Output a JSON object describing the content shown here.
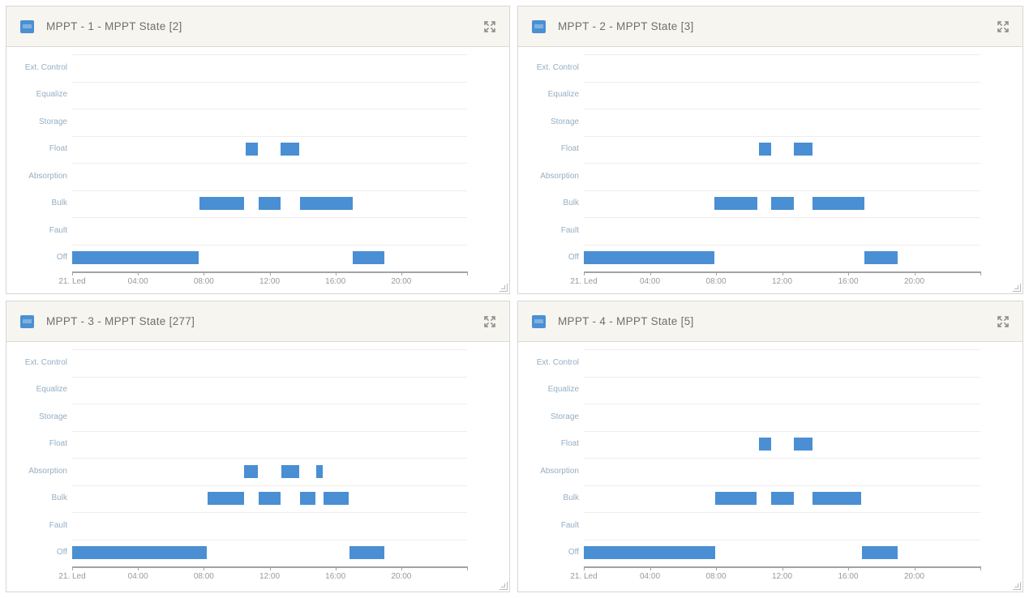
{
  "window": {
    "background": "#ffffff"
  },
  "ui": {
    "header_background": "#f7f5ef",
    "panel_border": "#d6d6d6",
    "widget_icon": "chart-widget-icon",
    "expand_icon": "expand-arrows-icon",
    "resize_icon": "resize-corner-icon"
  },
  "colors": {
    "bar": "#4a8fd3",
    "widget_icon_bg": "#4a90d4",
    "widget_icon_stripe": "#7fb2de",
    "y_label": "#96aec3",
    "x_label": "#999999",
    "title": "#6f6f6f",
    "grid_line": "#ededed",
    "axis_line": "#a3a3a3",
    "expand_icon_color": "#8a8a8a"
  },
  "chart_data": [
    {
      "type": "bar",
      "subtype": "state-timeline",
      "title": "MPPT - 1 - MPPT State [2]",
      "categories": [
        "Ext. Control",
        "Equalize",
        "Storage",
        "Float",
        "Absorption",
        "Bulk",
        "Fault",
        "Off"
      ],
      "x_axis": {
        "tick_labels": [
          "21. Led",
          "04:00",
          "08:00",
          "12:00",
          "16:00",
          "20:00"
        ],
        "range_hours": [
          0,
          24
        ],
        "tick_interval_hours": 4,
        "grid": false
      },
      "legend": "none",
      "segments": [
        {
          "state": "Off",
          "start_h": 0.0,
          "end_h": 7.7
        },
        {
          "state": "Bulk",
          "start_h": 7.75,
          "end_h": 10.45
        },
        {
          "state": "Float",
          "start_h": 10.55,
          "end_h": 11.3
        },
        {
          "state": "Bulk",
          "start_h": 11.35,
          "end_h": 12.65
        },
        {
          "state": "Float",
          "start_h": 12.65,
          "end_h": 13.8
        },
        {
          "state": "Bulk",
          "start_h": 13.85,
          "end_h": 17.05
        },
        {
          "state": "Off",
          "start_h": 17.05,
          "end_h": 18.95
        }
      ]
    },
    {
      "type": "bar",
      "subtype": "state-timeline",
      "title": "MPPT - 2 - MPPT State [3]",
      "categories": [
        "Ext. Control",
        "Equalize",
        "Storage",
        "Float",
        "Absorption",
        "Bulk",
        "Fault",
        "Off"
      ],
      "x_axis": {
        "tick_labels": [
          "21. Led",
          "04:00",
          "08:00",
          "12:00",
          "16:00",
          "20:00"
        ],
        "range_hours": [
          0,
          24
        ],
        "tick_interval_hours": 4,
        "grid": false
      },
      "legend": "none",
      "segments": [
        {
          "state": "Off",
          "start_h": 0.0,
          "end_h": 7.9
        },
        {
          "state": "Bulk",
          "start_h": 7.9,
          "end_h": 10.5
        },
        {
          "state": "Float",
          "start_h": 10.6,
          "end_h": 11.35
        },
        {
          "state": "Bulk",
          "start_h": 11.35,
          "end_h": 12.7
        },
        {
          "state": "Float",
          "start_h": 12.7,
          "end_h": 13.85
        },
        {
          "state": "Bulk",
          "start_h": 13.85,
          "end_h": 17.0
        },
        {
          "state": "Off",
          "start_h": 17.0,
          "end_h": 19.0
        }
      ]
    },
    {
      "type": "bar",
      "subtype": "state-timeline",
      "title": "MPPT - 3 - MPPT State [277]",
      "categories": [
        "Ext. Control",
        "Equalize",
        "Storage",
        "Float",
        "Absorption",
        "Bulk",
        "Fault",
        "Off"
      ],
      "x_axis": {
        "tick_labels": [
          "21. Led",
          "04:00",
          "08:00",
          "12:00",
          "16:00",
          "20:00"
        ],
        "range_hours": [
          0,
          24
        ],
        "tick_interval_hours": 4,
        "grid": false
      },
      "legend": "none",
      "segments": [
        {
          "state": "Off",
          "start_h": 0.0,
          "end_h": 8.2
        },
        {
          "state": "Bulk",
          "start_h": 8.25,
          "end_h": 10.45
        },
        {
          "state": "Absorption",
          "start_h": 10.45,
          "end_h": 11.3
        },
        {
          "state": "Bulk",
          "start_h": 11.35,
          "end_h": 12.65
        },
        {
          "state": "Absorption",
          "start_h": 12.7,
          "end_h": 13.8
        },
        {
          "state": "Bulk",
          "start_h": 13.85,
          "end_h": 14.8
        },
        {
          "state": "Absorption",
          "start_h": 14.85,
          "end_h": 15.25
        },
        {
          "state": "Bulk",
          "start_h": 15.3,
          "end_h": 16.8
        },
        {
          "state": "Off",
          "start_h": 16.85,
          "end_h": 18.95
        }
      ]
    },
    {
      "type": "bar",
      "subtype": "state-timeline",
      "title": "MPPT - 4 - MPPT State [5]",
      "categories": [
        "Ext. Control",
        "Equalize",
        "Storage",
        "Float",
        "Absorption",
        "Bulk",
        "Fault",
        "Off"
      ],
      "x_axis": {
        "tick_labels": [
          "21. Led",
          "04:00",
          "08:00",
          "12:00",
          "16:00",
          "20:00"
        ],
        "range_hours": [
          0,
          24
        ],
        "tick_interval_hours": 4,
        "grid": false
      },
      "legend": "none",
      "segments": [
        {
          "state": "Off",
          "start_h": 0.0,
          "end_h": 7.95
        },
        {
          "state": "Bulk",
          "start_h": 7.95,
          "end_h": 10.45
        },
        {
          "state": "Float",
          "start_h": 10.6,
          "end_h": 11.35
        },
        {
          "state": "Bulk",
          "start_h": 11.35,
          "end_h": 12.7
        },
        {
          "state": "Float",
          "start_h": 12.7,
          "end_h": 13.85
        },
        {
          "state": "Bulk",
          "start_h": 13.85,
          "end_h": 16.8
        },
        {
          "state": "Off",
          "start_h": 16.85,
          "end_h": 19.0
        }
      ]
    }
  ]
}
